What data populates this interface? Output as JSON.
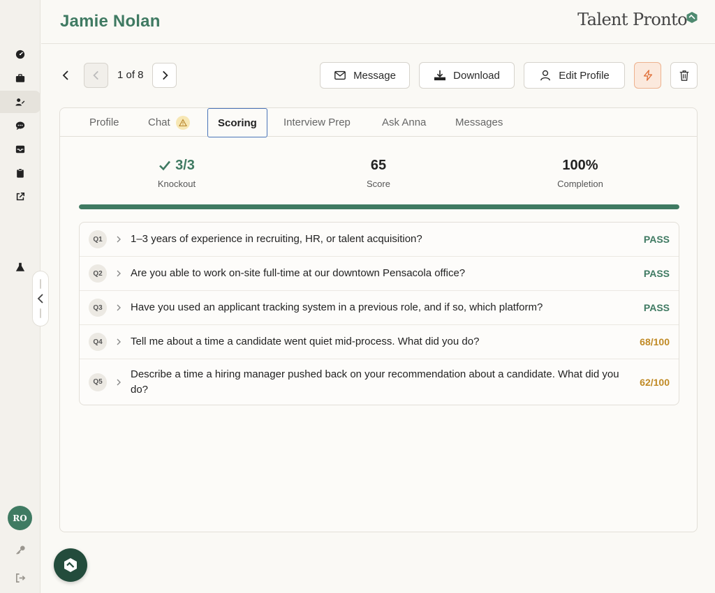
{
  "candidate": {
    "name": "Jamie Nolan"
  },
  "brand": {
    "logo_text": "Talent Pronto"
  },
  "sidebar": {
    "avatar_initials": "RO",
    "items": [
      {
        "icon": "dashboard-icon"
      },
      {
        "icon": "briefcase-icon"
      },
      {
        "icon": "candidates-icon",
        "active": true
      },
      {
        "icon": "chat-icon"
      },
      {
        "icon": "inbox-icon"
      },
      {
        "icon": "clipboard-icon"
      },
      {
        "icon": "external-link-icon"
      },
      {
        "icon": "flask-icon"
      }
    ],
    "footer": [
      {
        "icon": "key-icon"
      },
      {
        "icon": "logout-icon"
      }
    ]
  },
  "toolbar": {
    "pager_text": "1 of 8",
    "message_label": "Message",
    "download_label": "Download",
    "edit_profile_label": "Edit Profile"
  },
  "tabs": [
    {
      "label": "Profile"
    },
    {
      "label": "Chat",
      "warning": true
    },
    {
      "label": "Scoring",
      "active": true
    },
    {
      "label": "Interview Prep"
    },
    {
      "label": "Ask Anna"
    },
    {
      "label": "Messages"
    }
  ],
  "stats": {
    "knockout": {
      "value": "3/3",
      "label": "Knockout"
    },
    "score": {
      "value": "65",
      "label": "Score"
    },
    "completion": {
      "value": "100%",
      "label": "Completion",
      "fraction": 1.0
    }
  },
  "questions": [
    {
      "num": "Q1",
      "text": "1–3 years of experience in recruiting, HR, or talent acquisition?",
      "result": "PASS",
      "status": "pass"
    },
    {
      "num": "Q2",
      "text": "Are you able to work on-site full-time at our downtown Pensacola office?",
      "result": "PASS",
      "status": "pass"
    },
    {
      "num": "Q3",
      "text": "Have you used an applicant tracking system in a previous role, and if so, which platform?",
      "result": "PASS",
      "status": "pass"
    },
    {
      "num": "Q4",
      "text": "Tell me about a time a candidate went quiet mid-process. What did you do?",
      "result": "68/100",
      "status": "scored"
    },
    {
      "num": "Q5",
      "text": "Describe a time a hiring manager pushed back on your recommendation about a candidate. What did you do?",
      "result": "62/100",
      "status": "scored"
    }
  ],
  "colors": {
    "accent": "#3f7a62",
    "score_mid": "#c08a25",
    "tab_focus": "#4a74b8",
    "bolt": "#e0703a"
  }
}
